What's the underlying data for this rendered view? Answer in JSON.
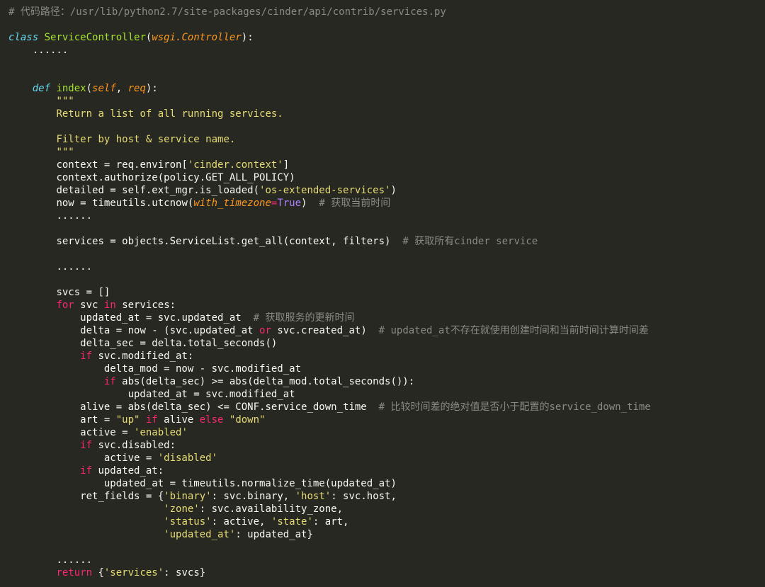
{
  "code": {
    "path_comment": "# 代码路径：/usr/lib/python2.7/site-packages/cinder/api/contrib/services.py",
    "kw_class": "class",
    "classname": "ServiceController",
    "base": "wsgi.Controller",
    "dots": "......",
    "kw_def": "def",
    "funcname": "index",
    "kw_self": "self",
    "arg_req": "req",
    "doc_q1": "\"\"\"",
    "doc_l1": "Return a list of all running services.",
    "doc_l2": "Filter by host & service name.",
    "doc_q2": "\"\"\"",
    "l_context": "context = req.environ[",
    "s_cinder_ctx": "'cinder.context'",
    "l_context_end": "]",
    "l_authorize": "context.authorize(policy.GET_ALL_POLICY)",
    "l_detailed": "detailed = self.ext_mgr.is_loaded(",
    "s_os_ext": "'os-extended-services'",
    "l_now_a": "now = timeutils.utcnow(",
    "kw_with_tz": "with_timezone",
    "eq": "=",
    "val_true": "True",
    "rparen": ")",
    "cm_now": "# 获取当前时间",
    "l_services": "services = objects.ServiceList.get_all(context, filters)  ",
    "cm_services": "# 获取所有cinder service",
    "l_svcs": "svcs = []",
    "kw_for": "for",
    "var_svc": "svc",
    "kw_in": "in",
    "var_services2": "services:",
    "l_updated_at": "updated_at = svc.updated_at  ",
    "cm_updated_at": "# 获取服务的更新时间",
    "l_delta_a": "delta = now - (svc.updated_at ",
    "kw_or": "or",
    "l_delta_b": " svc.created_at)  ",
    "cm_delta": "# updated_at不存在就使用创建时间和当前时间计算时间差",
    "l_delta_sec": "delta_sec = delta.total_seconds()",
    "kw_if": "if",
    "l_if_mod": " svc.modified_at:",
    "l_delta_mod": "delta_mod = now - svc.modified_at",
    "l_if_abs": " abs(delta_sec) >= abs(delta_mod.total_seconds()):",
    "l_upd_mod": "updated_at = svc.modified_at",
    "l_alive": "alive = abs(delta_sec) <= CONF.service_down_time  ",
    "cm_alive": "# 比较时间差的绝对值是否小于配置的service_down_time",
    "l_art_a": "art = ",
    "s_up": "\"up\"",
    "kw_if2": " if ",
    "l_art_b": "alive ",
    "kw_else": "else",
    "s_down": " \"down\"",
    "l_active_a": "active = ",
    "s_enabled": "'enabled'",
    "l_if_disabled": " svc.disabled:",
    "l_active_b": "active = ",
    "s_disabled": "'disabled'",
    "l_if_updated": " updated_at:",
    "l_norm": "updated_at = timeutils.normalize_time(updated_at)",
    "l_ret1a": "ret_fields = {",
    "s_binary": "'binary'",
    "l_ret1b": ": svc.binary, ",
    "s_host": "'host'",
    "l_ret1c": ": svc.host,",
    "s_zone": "'zone'",
    "l_ret2b": ": svc.availability_zone,",
    "s_status": "'status'",
    "l_ret3b": ": active, ",
    "s_state": "'state'",
    "l_ret3c": ": art,",
    "s_updated_at": "'updated_at'",
    "l_ret4b": ": updated_at}",
    "kw_return": "return",
    "l_return_a": " {",
    "s_services_key": "'services'",
    "l_return_b": ": svcs}"
  }
}
